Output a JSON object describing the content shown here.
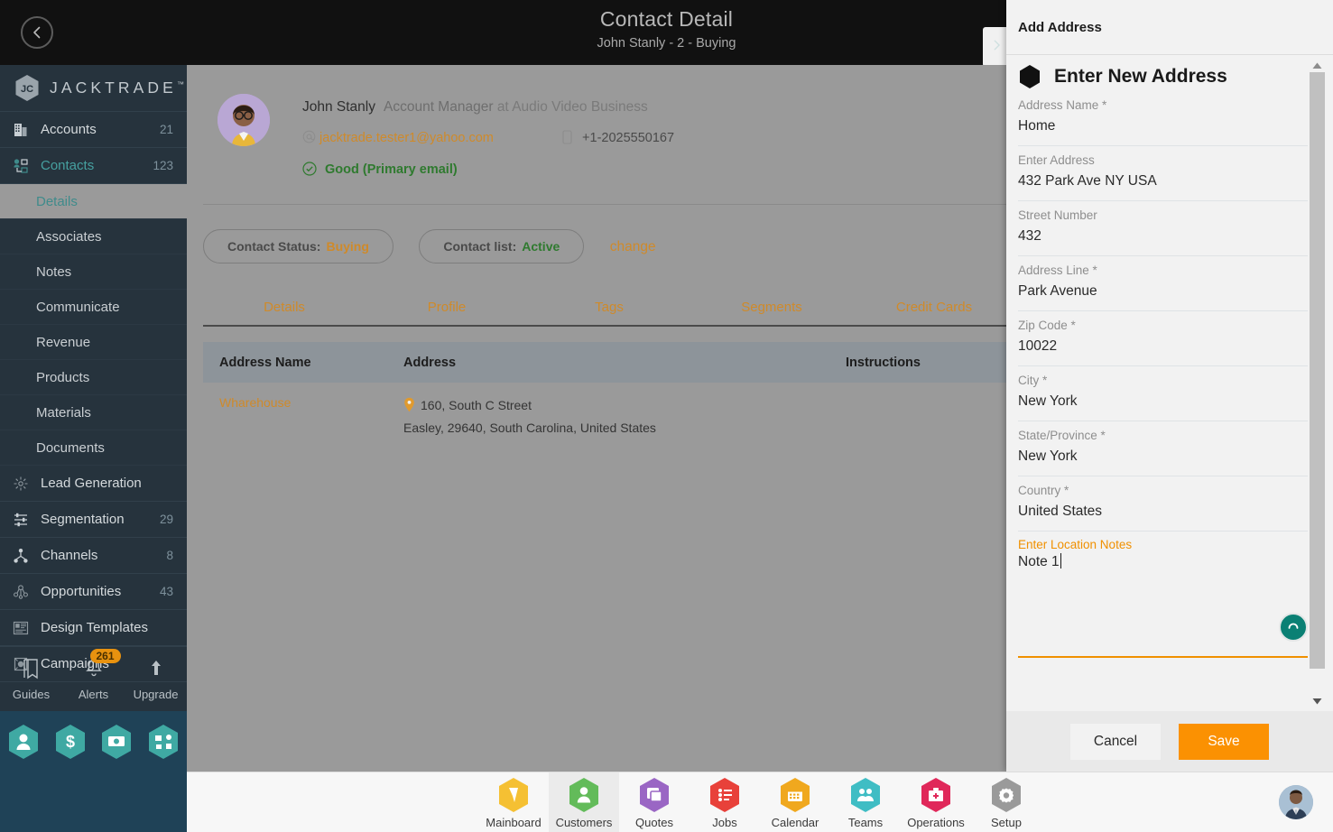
{
  "topbar": {
    "title": "Contact Detail",
    "subtitle": "John Stanly - 2 - Buying",
    "back_icon": "chevron-left-icon",
    "next_icon": "chevron-right-icon"
  },
  "sidebar": {
    "logo_text": "JACKTRADE",
    "logo_tm": "™",
    "items": [
      {
        "label": "Accounts",
        "count": "21",
        "icon": "building-icon",
        "active": false
      },
      {
        "label": "Contacts",
        "count": "123",
        "icon": "contacts-icon",
        "active": true
      }
    ],
    "sub_items": [
      {
        "label": "Details",
        "active": true
      },
      {
        "label": "Associates",
        "active": false
      },
      {
        "label": "Notes",
        "active": false
      },
      {
        "label": "Communicate",
        "active": false
      },
      {
        "label": "Revenue",
        "active": false
      },
      {
        "label": "Products",
        "active": false
      },
      {
        "label": "Materials",
        "active": false
      },
      {
        "label": "Documents",
        "active": false
      }
    ],
    "lower_items": [
      {
        "label": "Lead Generation",
        "count": "",
        "icon": "lead-generation-icon"
      },
      {
        "label": "Segmentation",
        "count": "29",
        "icon": "segmentation-icon"
      },
      {
        "label": "Channels",
        "count": "8",
        "icon": "channels-icon"
      },
      {
        "label": "Opportunities",
        "count": "43",
        "icon": "opportunities-icon"
      },
      {
        "label": "Design Templates",
        "count": "",
        "icon": "design-templates-icon"
      },
      {
        "label": "Campaigns",
        "count": "",
        "icon": "campaigns-icon"
      }
    ],
    "tools": [
      {
        "label": "Guides",
        "icon": "book-icon",
        "badge": ""
      },
      {
        "label": "Alerts",
        "icon": "bell-icon",
        "badge": "261"
      },
      {
        "label": "Upgrade",
        "icon": "arrow-up-icon",
        "badge": ""
      }
    ],
    "quick_icons": [
      "person-icon",
      "dollar-icon",
      "cash-icon",
      "workflow-icon"
    ]
  },
  "contact": {
    "name": "John Stanly",
    "role": "Account Manager",
    "at": "at",
    "company": "Audio Video Business",
    "email": "jacktrade.tester1@yahoo.com",
    "phone": "+1-2025550167",
    "email_status": "Good (Primary email)",
    "status_pill_label": "Contact Status:",
    "status_pill_value": "Buying",
    "list_pill_label": "Contact list:",
    "list_pill_value": "Active",
    "change_link": "change"
  },
  "tabs": [
    {
      "label": "Details"
    },
    {
      "label": "Profile"
    },
    {
      "label": "Tags"
    },
    {
      "label": "Segments"
    },
    {
      "label": "Credit Cards"
    }
  ],
  "address_table": {
    "columns": [
      "Address Name",
      "Address",
      "Instructions"
    ],
    "rows": [
      {
        "name": "Wharehouse",
        "line1": "160, South C Street",
        "line2": "Easley, 29640, South Carolina, United States",
        "instructions": ""
      }
    ]
  },
  "panel": {
    "header": "Add Address",
    "form_title": "Enter New Address",
    "fields": [
      {
        "label": "Address Name *",
        "value": "Home"
      },
      {
        "label": "Enter Address",
        "value": "432 Park Ave  NY  USA"
      },
      {
        "label": "Street Number",
        "value": "432"
      },
      {
        "label": "Address Line *",
        "value": "Park Avenue"
      },
      {
        "label": "Zip Code *",
        "value": "10022"
      },
      {
        "label": "City *",
        "value": "New York"
      },
      {
        "label": "State/Province *",
        "value": "New York"
      },
      {
        "label": "Country *",
        "value": "United States"
      }
    ],
    "notes": {
      "label": "Enter Location Notes",
      "value": "Note 1"
    },
    "cancel_label": "Cancel",
    "save_label": "Save",
    "accent_color": "#fb9102",
    "mic_color": "#0a8074"
  },
  "taskbar": {
    "items": [
      {
        "label": "Mainboard",
        "color": "#f5c033",
        "selected": false
      },
      {
        "label": "Customers",
        "color": "#63bb5a",
        "selected": true
      },
      {
        "label": "Quotes",
        "color": "#9a66c4",
        "selected": false
      },
      {
        "label": "Jobs",
        "color": "#e8413a",
        "selected": false
      },
      {
        "label": "Calendar",
        "color": "#f0a81e",
        "selected": false
      },
      {
        "label": "Teams",
        "color": "#3fbdc4",
        "selected": false
      },
      {
        "label": "Operations",
        "color": "#e0285a",
        "selected": false
      },
      {
        "label": "Setup",
        "color": "#9a9a9a",
        "selected": false
      }
    ]
  }
}
